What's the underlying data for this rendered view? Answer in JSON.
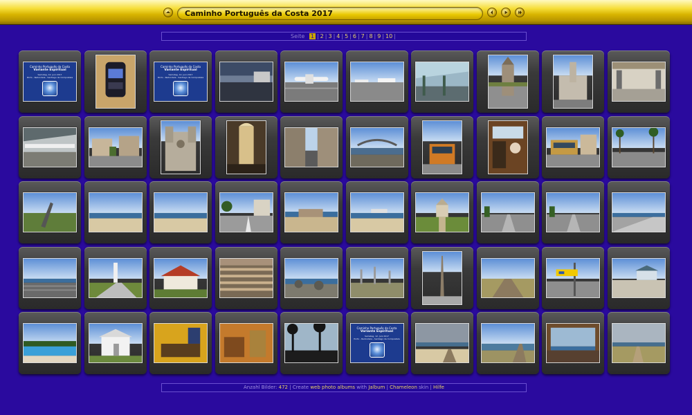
{
  "header": {
    "title": "Caminho Português da Costa 2017",
    "colors": {
      "bar": "#f6de3a",
      "background": "#2a0a9e"
    }
  },
  "pagination": {
    "label": "Seite",
    "current": "1",
    "pages": [
      "1",
      "2",
      "3",
      "4",
      "5",
      "6",
      "7",
      "8",
      "9",
      "10"
    ]
  },
  "cover": {
    "line1": "Caminho Português da Costa",
    "line2": "Variante Espiritual",
    "line3": "Samstag, 12. Juni 2017",
    "line4": "Porto - Redondela - Santiago de Compostela"
  },
  "footer": {
    "count_label": "Anzahl Bilder:",
    "count_value": "472",
    "create": "Create",
    "link_albums": "web photo albums",
    "with": "with",
    "link_jalbum": "Jalbum",
    "link_skin": "Chameleon",
    "skin": "skin",
    "link_help": "Hilfe"
  },
  "thumbnails": [
    {
      "kind": "cover",
      "orient": "land"
    },
    {
      "kind": "backpack",
      "orient": "port"
    },
    {
      "kind": "cover",
      "orient": "land"
    },
    {
      "kind": "airport-night",
      "orient": "land"
    },
    {
      "kind": "airplane",
      "orient": "land"
    },
    {
      "kind": "tarmac",
      "orient": "land"
    },
    {
      "kind": "metro-station",
      "orient": "land"
    },
    {
      "kind": "tower-church",
      "orient": "port"
    },
    {
      "kind": "city-hall",
      "orient": "port"
    },
    {
      "kind": "station-hall",
      "orient": "land"
    },
    {
      "kind": "platform",
      "orient": "land"
    },
    {
      "kind": "street-building",
      "orient": "land"
    },
    {
      "kind": "cathedral",
      "orient": "port"
    },
    {
      "kind": "cathedral-interior",
      "orient": "port"
    },
    {
      "kind": "narrow-street",
      "orient": "land"
    },
    {
      "kind": "bridge-river",
      "orient": "land"
    },
    {
      "kind": "tram",
      "orient": "port"
    },
    {
      "kind": "tram-interior",
      "orient": "port"
    },
    {
      "kind": "tram-street",
      "orient": "land"
    },
    {
      "kind": "palm-avenue",
      "orient": "land"
    },
    {
      "kind": "sculpture",
      "orient": "land"
    },
    {
      "kind": "beach",
      "orient": "land"
    },
    {
      "kind": "beach",
      "orient": "land"
    },
    {
      "kind": "promenade",
      "orient": "land"
    },
    {
      "kind": "fort",
      "orient": "land"
    },
    {
      "kind": "beach-pier",
      "orient": "land"
    },
    {
      "kind": "chapel",
      "orient": "land"
    },
    {
      "kind": "cycle-path",
      "orient": "land"
    },
    {
      "kind": "cycle-path",
      "orient": "land"
    },
    {
      "kind": "coast-road",
      "orient": "land"
    },
    {
      "kind": "amphitheatre",
      "orient": "land"
    },
    {
      "kind": "lighthouse",
      "orient": "land"
    },
    {
      "kind": "red-roof-house",
      "orient": "land"
    },
    {
      "kind": "boardwalk-close",
      "orient": "land"
    },
    {
      "kind": "rocky-coast",
      "orient": "land"
    },
    {
      "kind": "refinery",
      "orient": "land"
    },
    {
      "kind": "obelisk",
      "orient": "port"
    },
    {
      "kind": "boardwalk",
      "orient": "land"
    },
    {
      "kind": "way-sign",
      "orient": "land"
    },
    {
      "kind": "seaside-kiosk",
      "orient": "land"
    },
    {
      "kind": "pool",
      "orient": "land"
    },
    {
      "kind": "bungalow",
      "orient": "land"
    },
    {
      "kind": "room-yellow",
      "orient": "land"
    },
    {
      "kind": "room-orange",
      "orient": "land"
    },
    {
      "kind": "sunset-pines",
      "orient": "land"
    },
    {
      "kind": "cover",
      "orient": "land"
    },
    {
      "kind": "beach-dunes",
      "orient": "land"
    },
    {
      "kind": "estuary-boardwalk",
      "orient": "land"
    },
    {
      "kind": "terrace-sea",
      "orient": "land"
    },
    {
      "kind": "dune-path",
      "orient": "land"
    }
  ]
}
